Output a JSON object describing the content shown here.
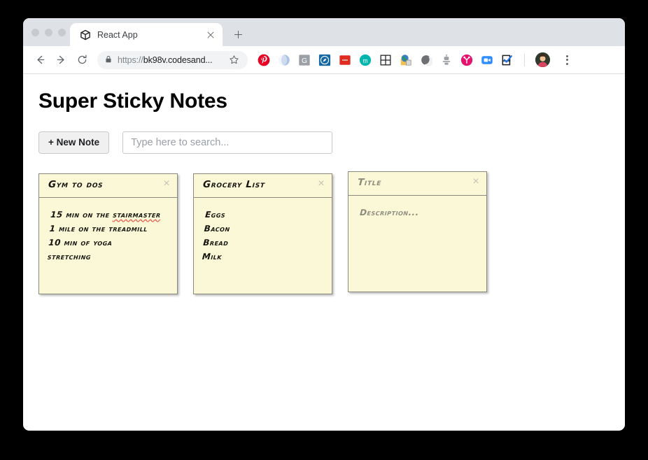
{
  "browser": {
    "tab": {
      "title": "React App",
      "favicon_icon": "codesandbox-cube-icon",
      "close_icon": "close-icon"
    },
    "new_tab_label": "+",
    "nav": {
      "back_icon": "arrow-left-icon",
      "forward_icon": "arrow-right-icon",
      "reload_icon": "reload-icon"
    },
    "omnibox": {
      "lock_icon": "lock-icon",
      "scheme": "https://",
      "host": "bk98v.codesand...",
      "star_icon": "star-icon"
    },
    "extensions": [
      {
        "name": "pinterest-extension-icon",
        "color": "#e60023"
      },
      {
        "name": "grammarly-extension-icon",
        "color": "#c7d6ea"
      },
      {
        "name": "grammarly-g-extension-icon",
        "color": "#9aa0a6"
      },
      {
        "name": "compass-extension-icon",
        "color": "#1769a5"
      },
      {
        "name": "red-dots-extension-icon",
        "color": "#e02b20"
      },
      {
        "name": "momentum-extension-icon",
        "color": "#00b5ad"
      },
      {
        "name": "grid-extension-icon",
        "color": "#202124"
      },
      {
        "name": "colorzilla-extension-icon",
        "color": "#e8a33d"
      },
      {
        "name": "moon-extension-icon",
        "color": "#5f6368"
      },
      {
        "name": "robot-extension-icon",
        "color": "#9aa0a6"
      },
      {
        "name": "tool-extension-icon",
        "color": "#e5136e"
      },
      {
        "name": "zoom-extension-icon",
        "color": "#2d8cff"
      },
      {
        "name": "checklist-extension-icon",
        "color": "#202124"
      }
    ],
    "avatar_name": "profile-avatar",
    "menu_icon": "kebab-menu-icon"
  },
  "app": {
    "title": "Super Sticky Notes",
    "new_note_label": "+ New Note",
    "search_placeholder": "Type here to search...",
    "search_value": "",
    "close_glyph": "×"
  },
  "notes": [
    {
      "title": "Gym to dos",
      "title_is_placeholder": false,
      "body_lines": [
        {
          "text": "15 min on the ",
          "misspelled": false
        },
        {
          "text": "stairmaster",
          "misspelled": true
        },
        {
          "text": "1 mile on the treadmill",
          "misspelled": false
        },
        {
          "text": "10 min of yoga",
          "misspelled": false
        },
        {
          "text": "stretching",
          "misspelled": false
        }
      ],
      "body_is_placeholder": false
    },
    {
      "title": "Grocery List",
      "title_is_placeholder": false,
      "body_lines": [
        {
          "text": "Eggs",
          "misspelled": false
        },
        {
          "text": "Bacon",
          "misspelled": false
        },
        {
          "text": "Bread",
          "misspelled": false
        },
        {
          "text": "Milk",
          "misspelled": false
        }
      ],
      "body_is_placeholder": false
    },
    {
      "title": "Title",
      "title_is_placeholder": true,
      "body_lines": [
        {
          "text": "Description...",
          "misspelled": false
        }
      ],
      "body_is_placeholder": true
    }
  ],
  "colors": {
    "note_paper": "#fbf8d7",
    "note_border": "#8a8a7e",
    "page_background": "#ffffff",
    "desktop_background": "#000000",
    "spellcheck_underline": "#e8594a"
  }
}
